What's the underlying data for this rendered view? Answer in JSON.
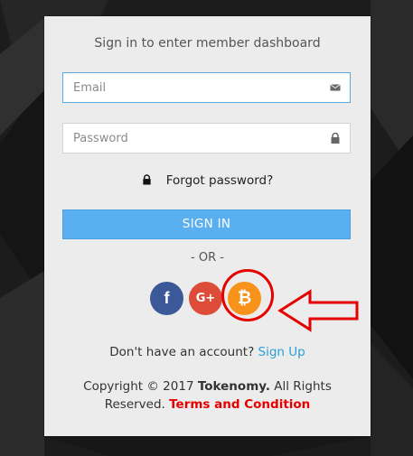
{
  "form": {
    "subtitle": "Sign in to enter member dashboard",
    "email_placeholder": "Email",
    "password_placeholder": "Password",
    "forgot_label": "Forgot password?",
    "signin_label": "SIGN IN",
    "or_label": "- OR -"
  },
  "social": [
    {
      "name": "facebook",
      "label": "f",
      "color": "#3b5998"
    },
    {
      "name": "google-plus",
      "label": "G+",
      "color": "#dd4b39"
    },
    {
      "name": "bitcoin",
      "label": "₿",
      "color": "#f7931a"
    }
  ],
  "footer": {
    "no_account": "Don't have an account?",
    "signup_label": "Sign Up",
    "copyright_prefix": "Copyright © 2017 ",
    "brand": "Tokenomy.",
    "copyright_suffix": " All Rights Reserved.",
    "terms_label": "Terms and Condition"
  },
  "annotation": {
    "color": "#e60000"
  }
}
